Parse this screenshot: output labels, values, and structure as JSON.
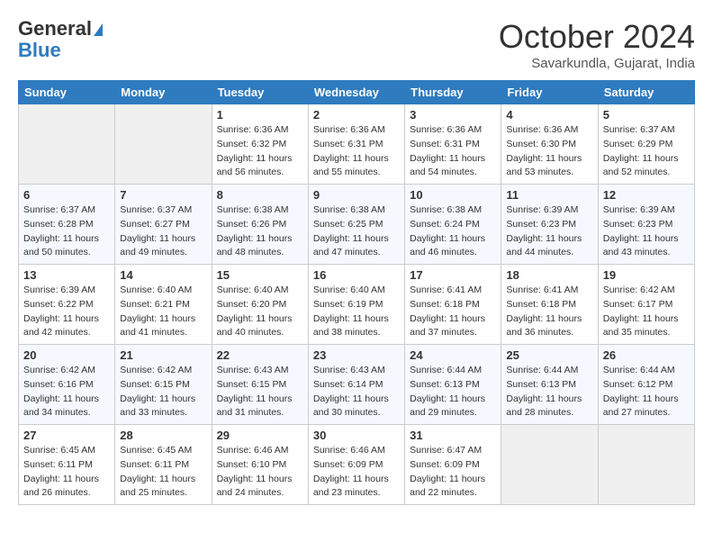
{
  "header": {
    "logo_general": "General",
    "logo_blue": "Blue",
    "month_title": "October 2024",
    "location": "Savarkundla, Gujarat, India"
  },
  "days_of_week": [
    "Sunday",
    "Monday",
    "Tuesday",
    "Wednesday",
    "Thursday",
    "Friday",
    "Saturday"
  ],
  "weeks": [
    [
      {
        "day": "",
        "empty": true
      },
      {
        "day": "",
        "empty": true
      },
      {
        "day": "1",
        "sunrise": "6:36 AM",
        "sunset": "6:32 PM",
        "daylight": "11 hours and 56 minutes."
      },
      {
        "day": "2",
        "sunrise": "6:36 AM",
        "sunset": "6:31 PM",
        "daylight": "11 hours and 55 minutes."
      },
      {
        "day": "3",
        "sunrise": "6:36 AM",
        "sunset": "6:31 PM",
        "daylight": "11 hours and 54 minutes."
      },
      {
        "day": "4",
        "sunrise": "6:36 AM",
        "sunset": "6:30 PM",
        "daylight": "11 hours and 53 minutes."
      },
      {
        "day": "5",
        "sunrise": "6:37 AM",
        "sunset": "6:29 PM",
        "daylight": "11 hours and 52 minutes."
      }
    ],
    [
      {
        "day": "6",
        "sunrise": "6:37 AM",
        "sunset": "6:28 PM",
        "daylight": "11 hours and 50 minutes."
      },
      {
        "day": "7",
        "sunrise": "6:37 AM",
        "sunset": "6:27 PM",
        "daylight": "11 hours and 49 minutes."
      },
      {
        "day": "8",
        "sunrise": "6:38 AM",
        "sunset": "6:26 PM",
        "daylight": "11 hours and 48 minutes."
      },
      {
        "day": "9",
        "sunrise": "6:38 AM",
        "sunset": "6:25 PM",
        "daylight": "11 hours and 47 minutes."
      },
      {
        "day": "10",
        "sunrise": "6:38 AM",
        "sunset": "6:24 PM",
        "daylight": "11 hours and 46 minutes."
      },
      {
        "day": "11",
        "sunrise": "6:39 AM",
        "sunset": "6:23 PM",
        "daylight": "11 hours and 44 minutes."
      },
      {
        "day": "12",
        "sunrise": "6:39 AM",
        "sunset": "6:23 PM",
        "daylight": "11 hours and 43 minutes."
      }
    ],
    [
      {
        "day": "13",
        "sunrise": "6:39 AM",
        "sunset": "6:22 PM",
        "daylight": "11 hours and 42 minutes."
      },
      {
        "day": "14",
        "sunrise": "6:40 AM",
        "sunset": "6:21 PM",
        "daylight": "11 hours and 41 minutes."
      },
      {
        "day": "15",
        "sunrise": "6:40 AM",
        "sunset": "6:20 PM",
        "daylight": "11 hours and 40 minutes."
      },
      {
        "day": "16",
        "sunrise": "6:40 AM",
        "sunset": "6:19 PM",
        "daylight": "11 hours and 38 minutes."
      },
      {
        "day": "17",
        "sunrise": "6:41 AM",
        "sunset": "6:18 PM",
        "daylight": "11 hours and 37 minutes."
      },
      {
        "day": "18",
        "sunrise": "6:41 AM",
        "sunset": "6:18 PM",
        "daylight": "11 hours and 36 minutes."
      },
      {
        "day": "19",
        "sunrise": "6:42 AM",
        "sunset": "6:17 PM",
        "daylight": "11 hours and 35 minutes."
      }
    ],
    [
      {
        "day": "20",
        "sunrise": "6:42 AM",
        "sunset": "6:16 PM",
        "daylight": "11 hours and 34 minutes."
      },
      {
        "day": "21",
        "sunrise": "6:42 AM",
        "sunset": "6:15 PM",
        "daylight": "11 hours and 33 minutes."
      },
      {
        "day": "22",
        "sunrise": "6:43 AM",
        "sunset": "6:15 PM",
        "daylight": "11 hours and 31 minutes."
      },
      {
        "day": "23",
        "sunrise": "6:43 AM",
        "sunset": "6:14 PM",
        "daylight": "11 hours and 30 minutes."
      },
      {
        "day": "24",
        "sunrise": "6:44 AM",
        "sunset": "6:13 PM",
        "daylight": "11 hours and 29 minutes."
      },
      {
        "day": "25",
        "sunrise": "6:44 AM",
        "sunset": "6:13 PM",
        "daylight": "11 hours and 28 minutes."
      },
      {
        "day": "26",
        "sunrise": "6:44 AM",
        "sunset": "6:12 PM",
        "daylight": "11 hours and 27 minutes."
      }
    ],
    [
      {
        "day": "27",
        "sunrise": "6:45 AM",
        "sunset": "6:11 PM",
        "daylight": "11 hours and 26 minutes."
      },
      {
        "day": "28",
        "sunrise": "6:45 AM",
        "sunset": "6:11 PM",
        "daylight": "11 hours and 25 minutes."
      },
      {
        "day": "29",
        "sunrise": "6:46 AM",
        "sunset": "6:10 PM",
        "daylight": "11 hours and 24 minutes."
      },
      {
        "day": "30",
        "sunrise": "6:46 AM",
        "sunset": "6:09 PM",
        "daylight": "11 hours and 23 minutes."
      },
      {
        "day": "31",
        "sunrise": "6:47 AM",
        "sunset": "6:09 PM",
        "daylight": "11 hours and 22 minutes."
      },
      {
        "day": "",
        "empty": true
      },
      {
        "day": "",
        "empty": true
      }
    ]
  ]
}
